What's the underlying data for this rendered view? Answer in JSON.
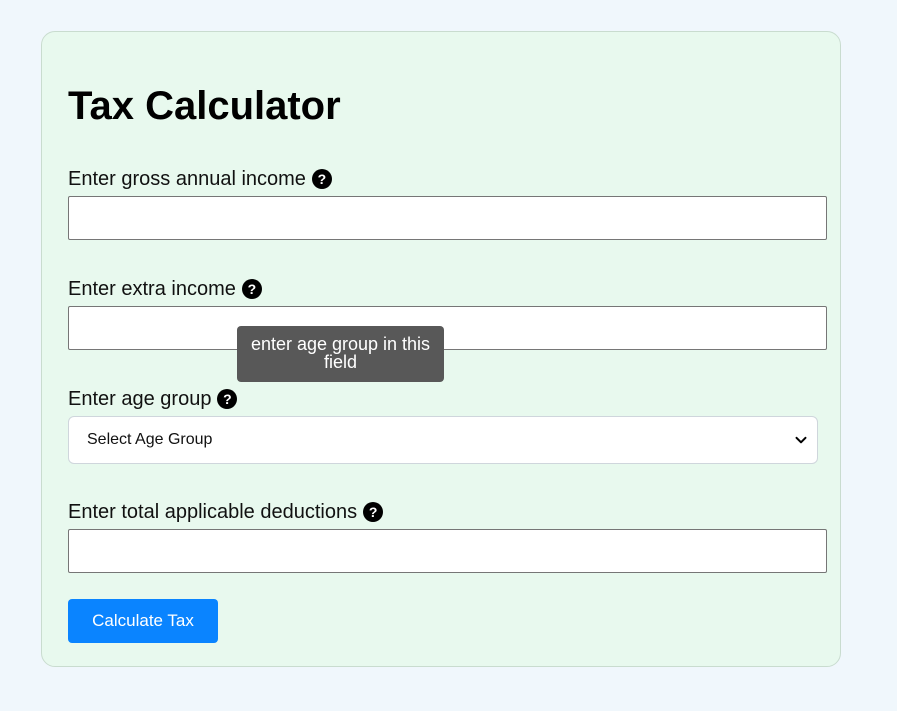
{
  "form": {
    "title": "Tax Calculator",
    "gross_income": {
      "label": "Enter gross annual income",
      "value": ""
    },
    "extra_income": {
      "label": "Enter extra income",
      "value": ""
    },
    "age_group": {
      "label": "Enter age group",
      "selected": "Select Age Group"
    },
    "deductions": {
      "label": "Enter total applicable deductions",
      "value": ""
    },
    "help_glyph": "?",
    "tooltip": "enter age group in this field",
    "submit_label": "Calculate Tax"
  },
  "colors": {
    "page_background": "#f0f7fc",
    "card_background": "#e8f9ee",
    "button": "#0a84ff",
    "tooltip": "#585858"
  },
  "icons": [
    "question-circle-icon",
    "chevron-down-icon"
  ]
}
